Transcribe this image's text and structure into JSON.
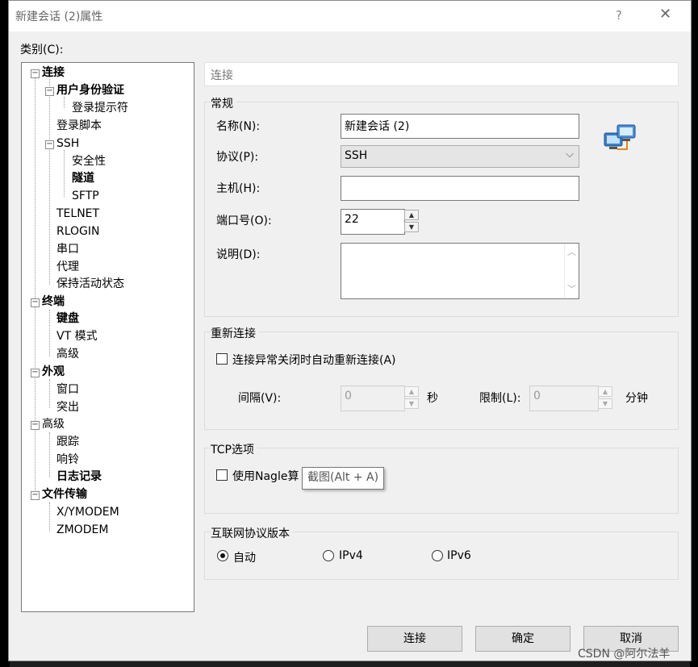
{
  "window": {
    "title": "新建会话 (2)属性",
    "help": "?",
    "close": "✕"
  },
  "category_label": "类别(C):",
  "tree": {
    "items": [
      {
        "label": "连接",
        "bold": true
      },
      {
        "label": "用户身份验证",
        "bold": true
      },
      {
        "label": "登录提示符",
        "bold": false
      },
      {
        "label": "登录脚本",
        "bold": false
      },
      {
        "label": "SSH",
        "bold": false
      },
      {
        "label": "安全性",
        "bold": false
      },
      {
        "label": "隧道",
        "bold": true
      },
      {
        "label": "SFTP",
        "bold": false
      },
      {
        "label": "TELNET",
        "bold": false
      },
      {
        "label": "RLOGIN",
        "bold": false
      },
      {
        "label": "串口",
        "bold": false
      },
      {
        "label": "代理",
        "bold": false
      },
      {
        "label": "保持活动状态",
        "bold": false
      },
      {
        "label": "终端",
        "bold": true
      },
      {
        "label": "键盘",
        "bold": true
      },
      {
        "label": "VT 模式",
        "bold": false
      },
      {
        "label": "高级",
        "bold": false
      },
      {
        "label": "外观",
        "bold": true
      },
      {
        "label": "窗口",
        "bold": false
      },
      {
        "label": "突出",
        "bold": false
      },
      {
        "label": "高级",
        "bold": false
      },
      {
        "label": "跟踪",
        "bold": false
      },
      {
        "label": "响铃",
        "bold": false
      },
      {
        "label": "日志记录",
        "bold": true
      },
      {
        "label": "文件传输",
        "bold": true
      },
      {
        "label": "X/YMODEM",
        "bold": false
      },
      {
        "label": "ZMODEM",
        "bold": false
      }
    ],
    "expander_symbol": "−"
  },
  "section_title": "连接",
  "general": {
    "title": "常规",
    "name_label": "名称(N):",
    "name_value": "新建会话 (2)",
    "protocol_label": "协议(P):",
    "protocol_value": "SSH",
    "host_label": "主机(H):",
    "host_value": "",
    "port_label": "端口号(O):",
    "port_value": "22",
    "desc_label": "说明(D):",
    "desc_value": ""
  },
  "reconnect": {
    "title": "重新连接",
    "checkbox_label": "连接异常关闭时自动重新连接(A)",
    "interval_label": "间隔(V):",
    "interval_value": "0",
    "interval_unit": "秒",
    "limit_label": "限制(L):",
    "limit_value": "0",
    "limit_unit": "分钟"
  },
  "tcp": {
    "title": "TCP选项",
    "nagle_label": "使用Nagle算"
  },
  "tooltip": "截图(Alt + A)",
  "ip_version": {
    "title": "互联网协议版本",
    "options": [
      "自动",
      "IPv4",
      "IPv6"
    ],
    "selected": "自动"
  },
  "buttons": {
    "connect": "连接",
    "ok": "确定",
    "cancel": "取消"
  },
  "watermark": "CSDN @阿尔法羊",
  "glyphs": {
    "chevron_down": "⌵",
    "spin_up": "▲",
    "spin_down": "▼",
    "scroll_up": "︿",
    "scroll_down": "﹀"
  }
}
